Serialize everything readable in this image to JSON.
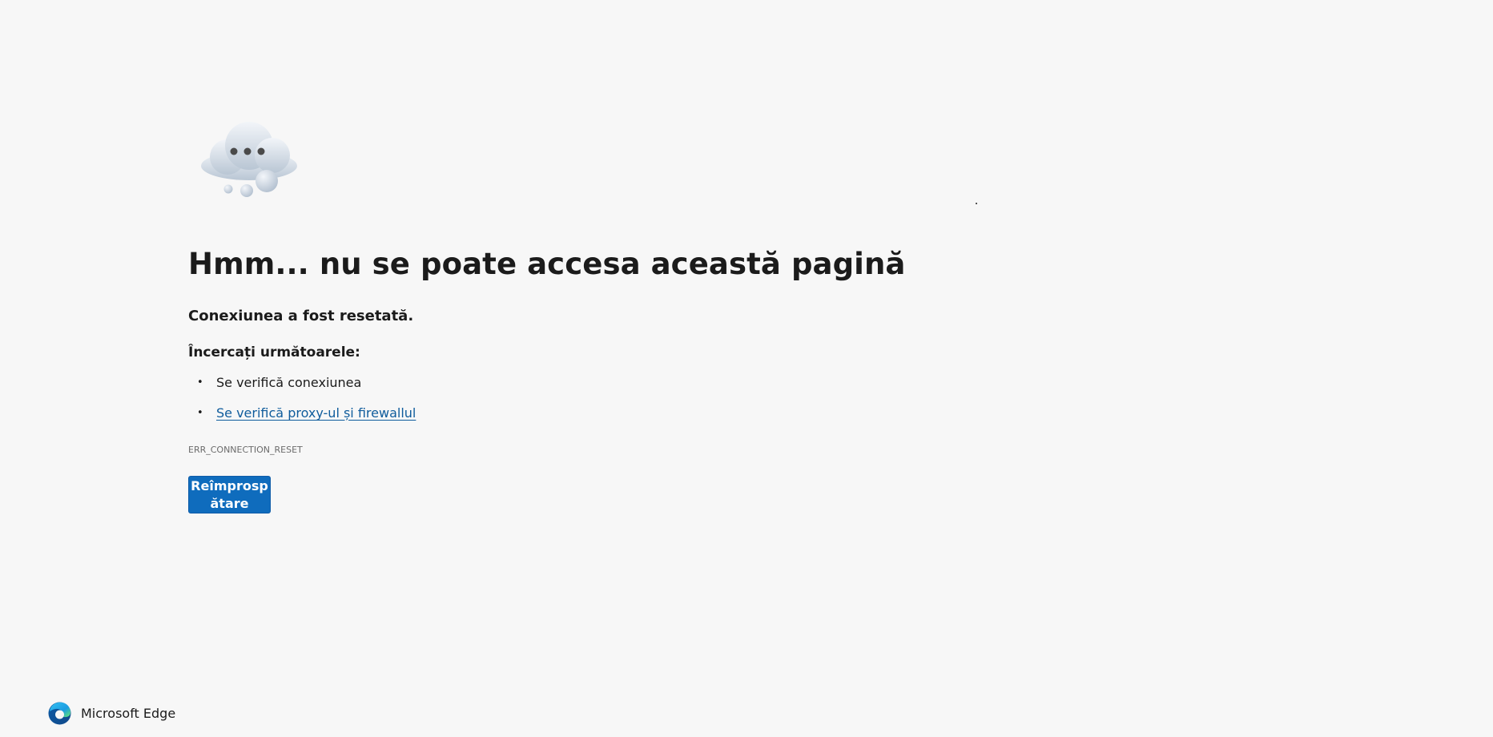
{
  "error_page": {
    "heading": "Hmm... nu se poate accesa această pagină",
    "subtitle": "Conexiunea a fost resetată.",
    "try_heading": "Încercați următoarele:",
    "suggestions": [
      {
        "text": "Se verifică conexiunea",
        "is_link": false
      },
      {
        "text": "Se verifică proxy-ul și firewallul",
        "is_link": true
      }
    ],
    "bullet": "•",
    "error_code": "ERR_CONNECTION_RESET",
    "refresh_button_label": "Reîmprospătare"
  },
  "footer": {
    "brand_name": "Microsoft Edge"
  },
  "icons": {
    "illustration": "thinking-cloud-icon",
    "logo": "microsoft-edge-logo"
  },
  "colors": {
    "background": "#f7f7f7",
    "text": "#1b1b1b",
    "link": "#0f5c9c",
    "button": "#0f6cbd",
    "button_text": "#ffffff",
    "error_code": "#6b6b6b"
  }
}
